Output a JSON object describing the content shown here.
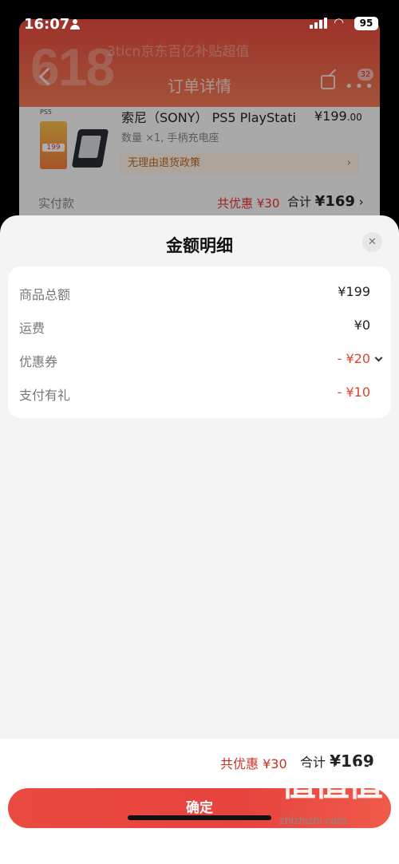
{
  "status_bar": {
    "time": "16:07",
    "battery": "95"
  },
  "background": {
    "banner_text": "618",
    "promo_text": "3ticn京东百亿补贴超值",
    "title": "订单详情",
    "notification_count": "32",
    "product": {
      "tag": "PS5",
      "promo_price": "199",
      "name": "索尼（SONY） PS5 PlayStati",
      "price_main": "¥199",
      "price_cents": ".00",
      "spec": "数量 ×1, 手柄充电座",
      "policy": "无理由退货政策"
    },
    "paid": {
      "label": "实付款",
      "discount": "共优惠 ¥30",
      "total_label": "合计",
      "total_value": "¥169"
    }
  },
  "sheet": {
    "title": "金额明细",
    "rows": [
      {
        "label": "商品总额",
        "value": "¥199"
      },
      {
        "label": "运费",
        "value": "¥0"
      },
      {
        "label": "优惠券",
        "value": "- ¥20"
      },
      {
        "label": "支付有礼",
        "value": "- ¥10"
      }
    ],
    "footer": {
      "discount": "共优惠 ¥30",
      "total_label": "合计",
      "total_value": "¥169"
    },
    "confirm_label": "确定"
  },
  "watermark": {
    "logo": "值值值",
    "url": "zhizhizhi.com"
  },
  "colors": {
    "accent_red": "#e2402d",
    "button_red": "#e6433d",
    "banner_red": "#e84a3e"
  }
}
